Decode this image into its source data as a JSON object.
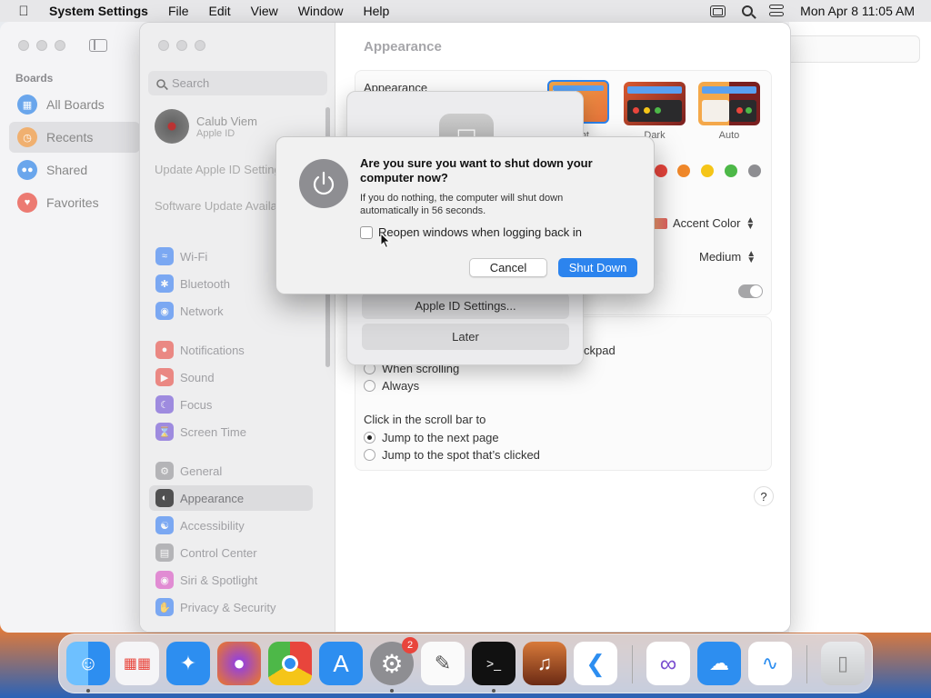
{
  "menubar": {
    "app": "System Settings",
    "items": [
      "File",
      "Edit",
      "View",
      "Window",
      "Help"
    ],
    "clock": "Mon Apr 8  11:05 AM"
  },
  "boards": {
    "heading": "Boards",
    "items": [
      {
        "label": "All Boards",
        "icon": "boards-icon",
        "color": "#4a90e2"
      },
      {
        "label": "Recents",
        "icon": "clock-icon",
        "color": "#f0a24a"
      },
      {
        "label": "Shared",
        "icon": "people-icon",
        "color": "#4a90e2"
      },
      {
        "label": "Favorites",
        "icon": "heart-icon",
        "color": "#e8453c"
      }
    ]
  },
  "sidebar": {
    "search_placeholder": "Search",
    "profile_name": "Calub Viem",
    "profile_sub": "Apple ID",
    "update_links": [
      "Update Apple ID Settings",
      "Software Update Available"
    ],
    "items": [
      {
        "label": "Wi-Fi",
        "icon": "wifi-icon",
        "color": "#2f7bf5"
      },
      {
        "label": "Bluetooth",
        "icon": "bluetooth-icon",
        "color": "#2f7bf5"
      },
      {
        "label": "Network",
        "icon": "globe-icon",
        "color": "#2f7bf5"
      },
      {
        "label": "Notifications",
        "icon": "bell-icon",
        "color": "#e8453c"
      },
      {
        "label": "Sound",
        "icon": "speaker-icon",
        "color": "#e8453c"
      },
      {
        "label": "Focus",
        "icon": "moon-icon",
        "color": "#6a4bd6"
      },
      {
        "label": "Screen Time",
        "icon": "hourglass-icon",
        "color": "#6a4bd6"
      },
      {
        "label": "General",
        "icon": "gear-icon",
        "color": "#8e8e92"
      },
      {
        "label": "Appearance",
        "icon": "appearance-icon",
        "color": "#222222",
        "selected": true
      },
      {
        "label": "Accessibility",
        "icon": "accessibility-icon",
        "color": "#2f7bf5"
      },
      {
        "label": "Control Center",
        "icon": "control-center-icon",
        "color": "#8e8e92"
      },
      {
        "label": "Siri & Spotlight",
        "icon": "siri-icon",
        "color": "#d94cc1"
      },
      {
        "label": "Privacy & Security",
        "icon": "hand-icon",
        "color": "#2f7bf5"
      }
    ]
  },
  "main": {
    "title": "Appearance",
    "appearance_label": "Appearance",
    "themes": [
      "Light",
      "Dark",
      "Auto"
    ],
    "accent_label": "Accent Color",
    "sidebar_size_value": "Medium",
    "accent_colors": [
      "#e8453c",
      "#f0882a",
      "#f5c518",
      "#4db848",
      "#8e8e92"
    ],
    "scroll_partial": "ckpad",
    "scroll_options": [
      "When scrolling",
      "Always"
    ],
    "click_label": "Click in the scroll bar to",
    "click_options": [
      "Jump to the next page",
      "Jump to the spot that’s clicked"
    ],
    "click_selected": 0,
    "help": "?"
  },
  "sheet": {
    "buttons": [
      "Apple ID Settings...",
      "Later"
    ]
  },
  "dialog": {
    "title": "Are you sure you want to shut down your computer now?",
    "message": "If you do nothing, the computer will shut down automatically in 56 seconds.",
    "checkbox_label": "Reopen windows when logging back in",
    "checkbox_checked": false,
    "cancel": "Cancel",
    "confirm": "Shut Down"
  },
  "dock": {
    "apps": [
      "Finder",
      "Launchpad",
      "Safari",
      "Firefox",
      "Chrome",
      "App Store",
      "System Settings",
      "TextEdit",
      "Terminal",
      "GarageBand",
      "VS Code",
      "Visual Studio",
      "OneDrive",
      "Freeform",
      "Trash"
    ],
    "settings_badge": "2"
  }
}
